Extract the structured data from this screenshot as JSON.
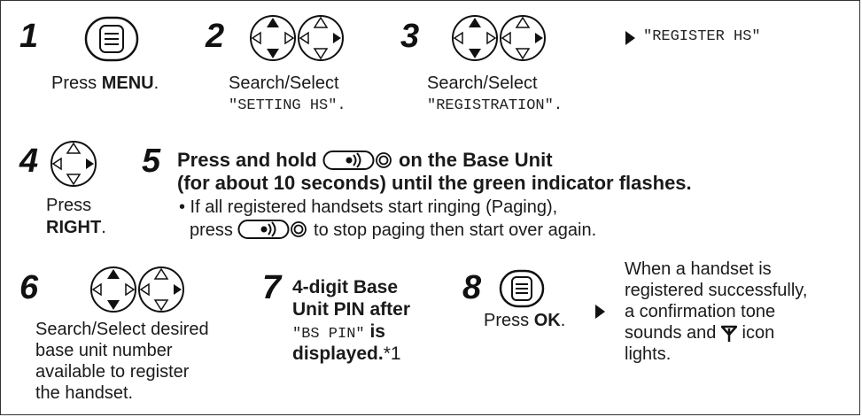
{
  "steps": {
    "s1": {
      "num": "1",
      "pre": "Press ",
      "bold": "MENU",
      "post": "."
    },
    "s2": {
      "num": "2",
      "line1": "Search/Select",
      "mono": "\"SETTING HS\"."
    },
    "s3": {
      "num": "3",
      "line1": "Search/Select",
      "mono": "\"REGISTRATION\".",
      "result": "\"REGISTER HS\""
    },
    "s4": {
      "num": "4",
      "line1": "Press",
      "bold": "RIGHT",
      "post": "."
    },
    "s5": {
      "num": "5",
      "l1a": "Press and hold",
      "l1b": "on the Base Unit",
      "l2": "(for about 10 seconds) until the green indicator flashes.",
      "b1": "• If all registered handsets start ringing (Paging),",
      "b2a": "press",
      "b2b": "to stop paging then start over again."
    },
    "s6": {
      "num": "6",
      "lines": [
        "Search/Select desired",
        "base unit number",
        "available to register",
        "the handset."
      ]
    },
    "s7": {
      "num": "7",
      "l1": "4-digit Base",
      "l2": "Unit PIN after",
      "mono": "\"BS PIN\"",
      "l3b": " is",
      "l4": "displayed.",
      "foot": "*1"
    },
    "s8": {
      "num": "8",
      "pre": "Press ",
      "bold": "OK",
      "post": ".",
      "result": [
        "When a handset is",
        "registered successfully,",
        "a confirmation tone",
        "sounds and",
        "icon",
        "lights."
      ]
    }
  },
  "icons": {
    "menu": "menu-button-icon",
    "nav": "navigator-key-icon",
    "locator": "locator-button-icon",
    "antenna": "antenna-icon",
    "arrow": "result-arrow-icon"
  }
}
